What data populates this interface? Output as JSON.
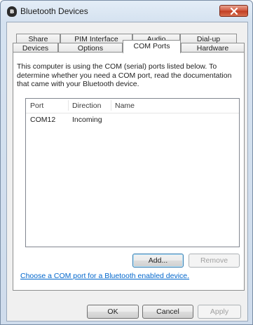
{
  "window": {
    "title": "Bluetooth Devices",
    "icon": "bluetooth-icon",
    "close_icon": "close-icon"
  },
  "tabs": {
    "row1": [
      {
        "label": "Share"
      },
      {
        "label": "PIM Interface"
      },
      {
        "label": "Audio"
      },
      {
        "label": "Dial-up"
      }
    ],
    "row2": [
      {
        "label": "Devices"
      },
      {
        "label": "Options"
      },
      {
        "label": "COM Ports",
        "active": true
      },
      {
        "label": "Hardware"
      }
    ]
  },
  "com_ports": {
    "description": "This computer is using the COM (serial) ports listed below. To determine whether you need a COM port, read the documentation that came with your Bluetooth device.",
    "columns": [
      "Port",
      "Direction",
      "Name"
    ],
    "rows": [
      {
        "port": "COM12",
        "direction": "Incoming",
        "name": ""
      }
    ],
    "add_label": "Add...",
    "remove_label": "Remove",
    "link_text": "Choose a COM port for a Bluetooth enabled device."
  },
  "footer": {
    "ok_label": "OK",
    "cancel_label": "Cancel",
    "apply_label": "Apply"
  },
  "colors": {
    "link": "#0066cc",
    "close_button": "#c8452c"
  }
}
